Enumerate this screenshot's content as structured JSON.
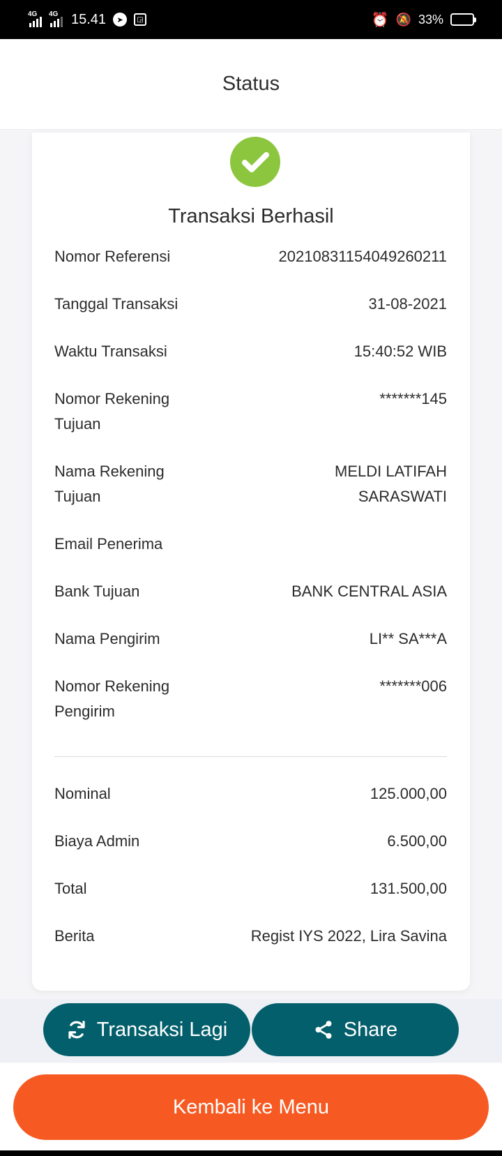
{
  "status_bar": {
    "network_1": "4G",
    "network_2": "4G",
    "time": "15.41",
    "battery": "33%",
    "battery_level": 0.33,
    "icons": [
      "telegram-icon",
      "screenshot-icon",
      "alarm-icon",
      "mute-icon",
      "battery-icon"
    ]
  },
  "header": {
    "title": "Status"
  },
  "result": {
    "title": "Transaksi Berhasil",
    "icon": "check-circle-icon",
    "icon_color": "#8cc63f"
  },
  "details": [
    {
      "label": "Nomor Referensi",
      "value": "20210831154049260211"
    },
    {
      "label": "Tanggal Transaksi",
      "value": "31-08-2021"
    },
    {
      "label": "Waktu Transaksi",
      "value": "15:40:52 WIB"
    },
    {
      "label": "Nomor Rekening Tujuan",
      "value": "*******145"
    },
    {
      "label": "Nama Rekening Tujuan",
      "value": "MELDI LATIFAH SARASWATI"
    },
    {
      "label": "Email Penerima",
      "value": ""
    },
    {
      "label": "Bank Tujuan",
      "value": "BANK CENTRAL ASIA"
    },
    {
      "label": "Nama Pengirim",
      "value": "LI** SA***A"
    },
    {
      "label": "Nomor Rekening Pengirim",
      "value": "*******006"
    }
  ],
  "amounts": [
    {
      "label": "Nominal",
      "value": "125.000,00"
    },
    {
      "label": "Biaya Admin",
      "value": "6.500,00"
    },
    {
      "label": "Total",
      "value": "131.500,00"
    },
    {
      "label": "Berita",
      "value": "Regist IYS 2022, Lira Savina"
    }
  ],
  "actions": {
    "again_label": "Transaksi Lagi",
    "share_label": "Share",
    "menu_label": "Kembali ke Menu"
  },
  "colors": {
    "primary": "#035f6b",
    "accent": "#f65a22",
    "success": "#8cc63f"
  }
}
